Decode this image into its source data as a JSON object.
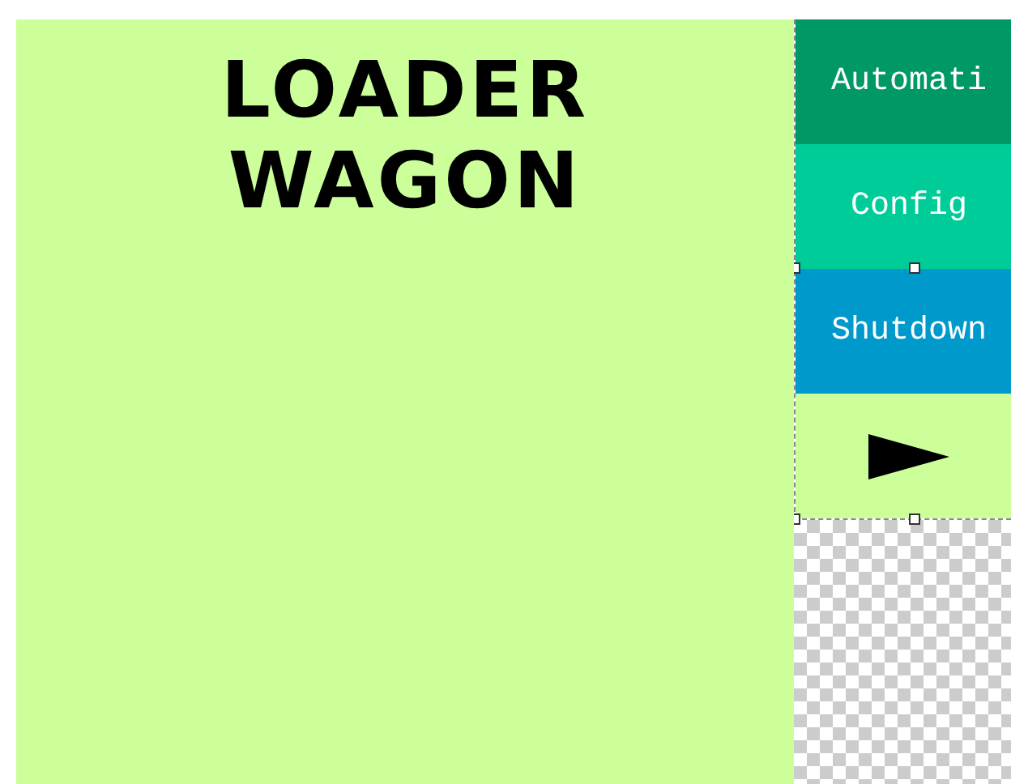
{
  "title": [
    "LOADER",
    "WAGON"
  ],
  "buttons": [
    {
      "label": "Automati",
      "color": "#009966"
    },
    {
      "label": "Config",
      "color": "#00cc99"
    },
    {
      "label": "Shutdown",
      "color": "#0099cc"
    }
  ],
  "next_button": {
    "kind": "arrow"
  }
}
